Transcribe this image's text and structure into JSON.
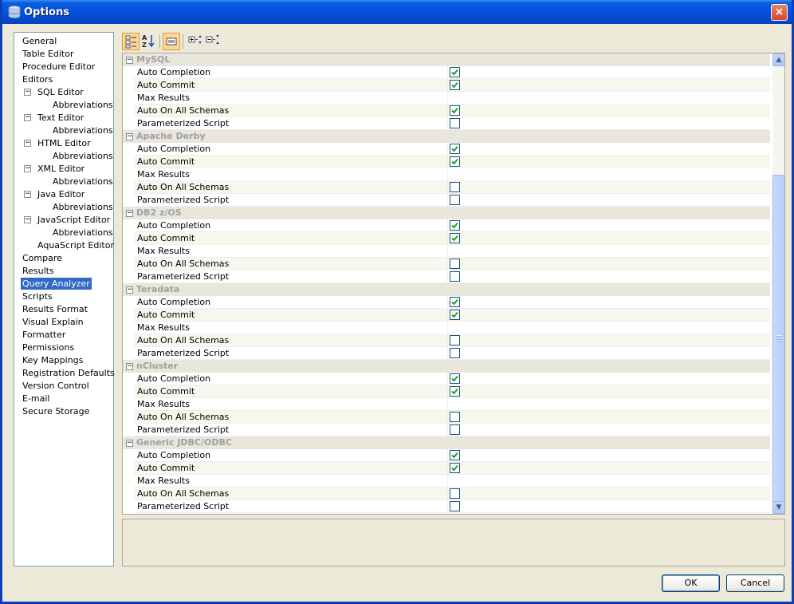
{
  "window": {
    "title": "Options",
    "close_label": "×"
  },
  "nav": {
    "items": [
      {
        "label": "General",
        "level": 0
      },
      {
        "label": "Table Editor",
        "level": 0
      },
      {
        "label": "Procedure Editor",
        "level": 0
      },
      {
        "label": "Editors",
        "level": 0
      },
      {
        "label": "SQL Editor",
        "level": 1,
        "toggle": "−"
      },
      {
        "label": "Abbreviations",
        "level": 2
      },
      {
        "label": "Text Editor",
        "level": 1,
        "toggle": "−"
      },
      {
        "label": "Abbreviations",
        "level": 2
      },
      {
        "label": "HTML Editor",
        "level": 1,
        "toggle": "−"
      },
      {
        "label": "Abbreviations",
        "level": 2
      },
      {
        "label": "XML Editor",
        "level": 1,
        "toggle": "−"
      },
      {
        "label": "Abbreviations",
        "level": 2
      },
      {
        "label": "Java Editor",
        "level": 1,
        "toggle": "−"
      },
      {
        "label": "Abbreviations",
        "level": 2
      },
      {
        "label": "JavaScript Editor",
        "level": 1,
        "toggle": "−"
      },
      {
        "label": "Abbreviations",
        "level": 2
      },
      {
        "label": "AquaScript Editor",
        "level": 1
      },
      {
        "label": "Compare",
        "level": 0
      },
      {
        "label": "Results",
        "level": 0
      },
      {
        "label": "Query Analyzer",
        "level": 0,
        "selected": true
      },
      {
        "label": "Scripts",
        "level": 0
      },
      {
        "label": "Results Format",
        "level": 0
      },
      {
        "label": "Visual Explain",
        "level": 0
      },
      {
        "label": "Formatter",
        "level": 0
      },
      {
        "label": "Permissions",
        "level": 0
      },
      {
        "label": "Key Mappings",
        "level": 0
      },
      {
        "label": "Registration Defaults",
        "level": 0
      },
      {
        "label": "Version Control",
        "level": 0
      },
      {
        "label": "E-mail",
        "level": 0
      },
      {
        "label": "Secure Storage",
        "level": 0
      }
    ]
  },
  "toolbar": {
    "buttons": [
      {
        "name": "categorized-view-icon",
        "active": true
      },
      {
        "name": "sort-alphabetical-icon",
        "active": false
      },
      {
        "name": "show-description-icon",
        "active": true
      },
      {
        "name": "expand-all-icon",
        "active": false
      },
      {
        "name": "collapse-all-icon",
        "active": false
      }
    ]
  },
  "grid": {
    "categories": [
      {
        "name": "MySQL",
        "props": [
          {
            "label": "Auto Completion",
            "type": "checkbox",
            "checked": true
          },
          {
            "label": "Auto Commit",
            "type": "checkbox",
            "checked": true
          },
          {
            "label": "Max Results",
            "type": "text",
            "value": ""
          },
          {
            "label": "Auto On All Schemas",
            "type": "checkbox",
            "checked": true
          },
          {
            "label": "Parameterized Script",
            "type": "checkbox",
            "checked": false
          }
        ]
      },
      {
        "name": "Apache Derby",
        "props": [
          {
            "label": "Auto Completion",
            "type": "checkbox",
            "checked": true
          },
          {
            "label": "Auto Commit",
            "type": "checkbox",
            "checked": true
          },
          {
            "label": "Max Results",
            "type": "text",
            "value": ""
          },
          {
            "label": "Auto On All Schemas",
            "type": "checkbox",
            "checked": false
          },
          {
            "label": "Parameterized Script",
            "type": "checkbox",
            "checked": false
          }
        ]
      },
      {
        "name": "DB2 z/OS",
        "props": [
          {
            "label": "Auto Completion",
            "type": "checkbox",
            "checked": true
          },
          {
            "label": "Auto Commit",
            "type": "checkbox",
            "checked": true
          },
          {
            "label": "Max Results",
            "type": "text",
            "value": ""
          },
          {
            "label": "Auto On All Schemas",
            "type": "checkbox",
            "checked": false
          },
          {
            "label": "Parameterized Script",
            "type": "checkbox",
            "checked": false
          }
        ]
      },
      {
        "name": "Teradata",
        "props": [
          {
            "label": "Auto Completion",
            "type": "checkbox",
            "checked": true
          },
          {
            "label": "Auto Commit",
            "type": "checkbox",
            "checked": true
          },
          {
            "label": "Max Results",
            "type": "text",
            "value": ""
          },
          {
            "label": "Auto On All Schemas",
            "type": "checkbox",
            "checked": false
          },
          {
            "label": "Parameterized Script",
            "type": "checkbox",
            "checked": false
          }
        ]
      },
      {
        "name": "nCluster",
        "props": [
          {
            "label": "Auto Completion",
            "type": "checkbox",
            "checked": true
          },
          {
            "label": "Auto Commit",
            "type": "checkbox",
            "checked": true
          },
          {
            "label": "Max Results",
            "type": "text",
            "value": ""
          },
          {
            "label": "Auto On All Schemas",
            "type": "checkbox",
            "checked": false
          },
          {
            "label": "Parameterized Script",
            "type": "checkbox",
            "checked": false
          }
        ]
      },
      {
        "name": "Generic JDBC/ODBC",
        "props": [
          {
            "label": "Auto Completion",
            "type": "checkbox",
            "checked": true
          },
          {
            "label": "Auto Commit",
            "type": "checkbox",
            "checked": true
          },
          {
            "label": "Max Results",
            "type": "text",
            "value": ""
          },
          {
            "label": "Auto On All Schemas",
            "type": "checkbox",
            "checked": false
          },
          {
            "label": "Parameterized Script",
            "type": "checkbox",
            "checked": false
          }
        ]
      }
    ]
  },
  "buttons": {
    "ok_label": "OK",
    "cancel_label": "Cancel"
  }
}
